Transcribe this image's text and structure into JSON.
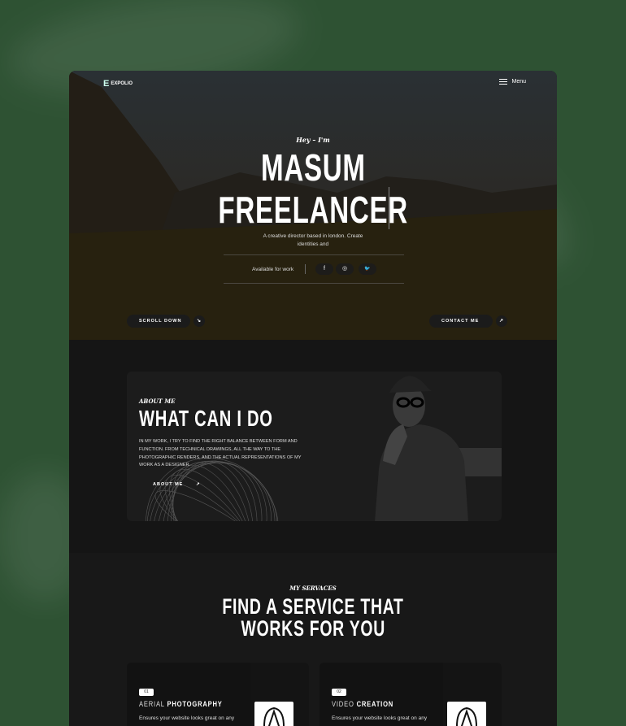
{
  "header": {
    "logo": "EXPOLIO",
    "menu_label": "Menu"
  },
  "hero": {
    "greeting": "Hey – I'm",
    "name_line1": "MASUM",
    "name_line2": "FREELANCER",
    "subtitle": "A creative director based in london. Create identities and",
    "availability": "Available for work",
    "socials": [
      {
        "icon": "facebook-icon",
        "glyph": "f"
      },
      {
        "icon": "instagram-icon",
        "glyph": "◎"
      },
      {
        "icon": "twitter-icon",
        "glyph": "🐦"
      }
    ],
    "scroll_label": "SCROLL DOWN",
    "contact_label": "CONTACT ME"
  },
  "about": {
    "eyebrow": "ABOUT ME",
    "title": "WHAT CAN I DO",
    "text": "In my work, I try to find the right balance between form and function. From technical drawings, all the way to the photographic renders, and the actual representations of my work as a designer.",
    "button_label": "ABOUT ME"
  },
  "services": {
    "eyebrow": "MY SERVACES",
    "title_line1": "FIND A SERVICE THAT",
    "title_line2": "WORKS FOR YOU",
    "items": [
      {
        "num": "01",
        "title_light": "AERIAL",
        "title_bold": "PHOTOGRAPHY",
        "desc": "Ensures your website looks great on any"
      },
      {
        "num": "02",
        "title_light": "VIDEO",
        "title_bold": "CREATION",
        "desc": "Ensures your website looks great on any"
      }
    ]
  },
  "colors": {
    "background": "#2e5233",
    "dark": "#161616",
    "accent": "#ffffff"
  }
}
